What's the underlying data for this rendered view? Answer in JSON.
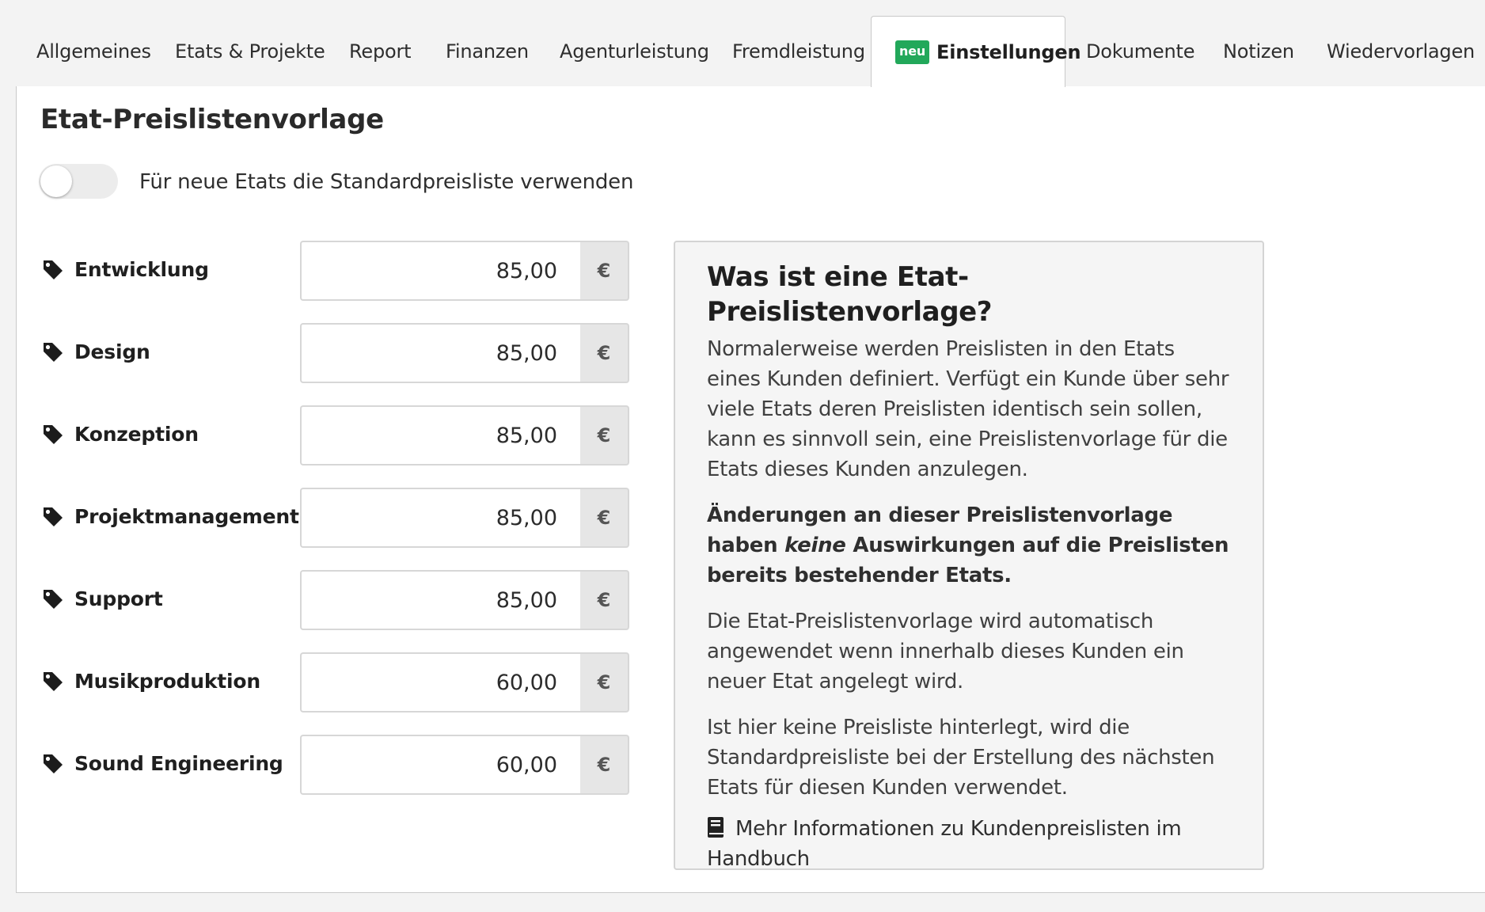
{
  "tabs": [
    {
      "label": "Allgemeines"
    },
    {
      "label": "Etats & Projekte"
    },
    {
      "label": "Report"
    },
    {
      "label": "Finanzen"
    },
    {
      "label": "Agenturleistung"
    },
    {
      "label": "Fremdleistung"
    },
    {
      "label": "Einstellungen",
      "badge": "neu",
      "active": true
    },
    {
      "label": "Dokumente"
    },
    {
      "label": "Notizen"
    },
    {
      "label": "Wiedervorlagen"
    }
  ],
  "page": {
    "title": "Etat-Preislistenvorlage",
    "toggle_label": "Für neue Etats die Standardpreisliste verwenden",
    "toggle_on": false
  },
  "prices": {
    "currency": "€",
    "rows": [
      {
        "label": "Entwicklung",
        "value": "85,00"
      },
      {
        "label": "Design",
        "value": "85,00"
      },
      {
        "label": "Konzeption",
        "value": "85,00"
      },
      {
        "label": "Projektmanagement",
        "value": "85,00"
      },
      {
        "label": "Support",
        "value": "85,00"
      },
      {
        "label": "Musikproduktion",
        "value": "60,00"
      },
      {
        "label": "Sound Engineering",
        "value": "60,00"
      }
    ]
  },
  "info": {
    "title": "Was ist eine Etat-Preislistenvorlage?",
    "p1": "Normalerweise werden Preislisten in den Etats eines Kunden definiert. Verfügt ein Kunde über sehr viele Etats deren Preislisten identisch sein sollen, kann es sinnvoll sein, eine Preislistenvorlage für die Etats dieses Kunden anzulegen.",
    "p2_before": "Änderungen an dieser Preislistenvorlage haben ",
    "p2_emph": "keine",
    "p2_after": " Auswirkungen auf die Preislisten bereits bestehender Etats.",
    "p3": "Die Etat-Preislistenvorlage wird automatisch angewendet wenn innerhalb dieses Kunden ein neuer Etat angelegt wird.",
    "p4": "Ist hier keine Preisliste hinterlegt, wird die Standardpreisliste bei der Erstellung des nächsten Etats für diesen Kunden verwendet.",
    "link": "Mehr Informationen zu Kundenpreislisten im Handbuch"
  },
  "icons": {
    "row_icon": "tag-icon",
    "link_icon": "book-icon"
  },
  "colors": {
    "badge_new": "#22a85a",
    "addon_bg": "#e6e6e6",
    "info_bg": "#f5f5f5"
  }
}
